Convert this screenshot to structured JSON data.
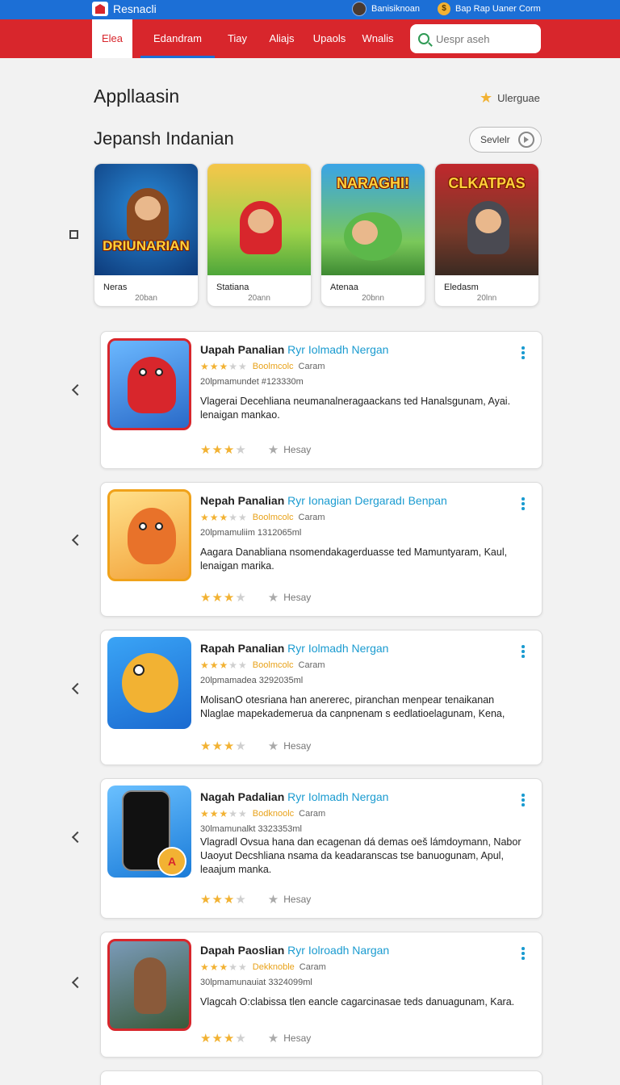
{
  "topbar": {
    "brand": "Resnacli",
    "user_name": "Banisiknoan",
    "account_label": "Bap Rap Uaner Corm"
  },
  "nav": {
    "tabs": [
      "Elea",
      "Edandram",
      "Tiay",
      "Aliajs",
      "Upaols",
      "Wnalis"
    ],
    "active_index": 1,
    "search_placeholder": "Uespr aseh"
  },
  "page": {
    "title": "Appllaasin",
    "language": "Ulerguae"
  },
  "featured": {
    "title": "Jepansh Indanian",
    "see_all": "Sevlelr",
    "items": [
      {
        "name": "Neras",
        "sub": "20ban",
        "art_text": "DRIUNARIAN"
      },
      {
        "name": "Statiana",
        "sub": "20ann",
        "art_text": ""
      },
      {
        "name": "Atenaa",
        "sub": "20bnn",
        "art_text": "NARAGHI!"
      },
      {
        "name": "Eledasm",
        "sub": "20lnn",
        "art_text": "CLKATPAS"
      }
    ]
  },
  "apps": [
    {
      "title": "Uapah Panalian",
      "developer": "Ryr Iolmadh Nergan",
      "rating": 3,
      "category": "Boolmcolc",
      "subcategory": "Caram",
      "meta": "20lpmamundet #123330m",
      "description": "Vlagerai Decehliana neumanalneragaackans ted Hanalsgunam, Ayai. lenaigan mankao.",
      "footer_rating": 3,
      "footer_label": "Hesay",
      "accent": "#d8262c"
    },
    {
      "title": "Nepah Panalian",
      "developer": "Ryr Ionagian Dergaradı Benpan",
      "rating": 3,
      "category": "Boolmcolc",
      "subcategory": "Caram",
      "meta": "20lpmamuliim 1312065ml",
      "description": "Aagara Danabliana nsomendakagerduasse ted Mamuntyaram, Kaul, lenaigan marika.",
      "footer_rating": 3,
      "footer_label": "Hesay",
      "accent": "#f0a21a"
    },
    {
      "title": "Rapah Panalian",
      "developer": "Ryr Iolmadh Nergan",
      "rating": 3,
      "category": "Boolmcolc",
      "subcategory": "Caram",
      "meta": "20lpmamadea 3292035ml",
      "description": "MolisanO otesriana han anererec, piranchan menpear tenaikanan Nlaglae mapekademerua da canpnenam s eedlatioelagunam, Kena,",
      "footer_rating": 3,
      "footer_label": "Hesay",
      "accent": "#1a7bd8"
    },
    {
      "title": "Nagah Padalian",
      "developer": "Ryr Iolmadh Nergan",
      "rating": 3,
      "category": "Bodknoolc",
      "subcategory": "Caram",
      "meta": "30lmamunalkt 3323353ml",
      "description": "Vlagradl Ovsua hana dan ecagenan dá demas oeš lámdoymann, Nabor Uaoyut Decshliana nsama da keadaranscas tse banuogunam, Apul, leaajum manka.",
      "footer_rating": 3,
      "footer_label": "Hesay",
      "accent": "#1a7bd8"
    },
    {
      "title": "Dapah Paoslian",
      "developer": "Ryr Iolroadh Nargan",
      "rating": 3,
      "category": "Dekknoble",
      "subcategory": "Caram",
      "meta": "30lpmamunauiat 3324099ml",
      "description": "Vlagcah O:clabissa tlen eancle cagarcinasae teds danuagunam, Kara.",
      "footer_rating": 3,
      "footer_label": "Hesay",
      "accent": "#d8262c"
    }
  ],
  "colors": {
    "topbar": "#1c6fd6",
    "navbar": "#d8262c",
    "star": "#f2b233",
    "developer_link": "#1a9bd0"
  }
}
